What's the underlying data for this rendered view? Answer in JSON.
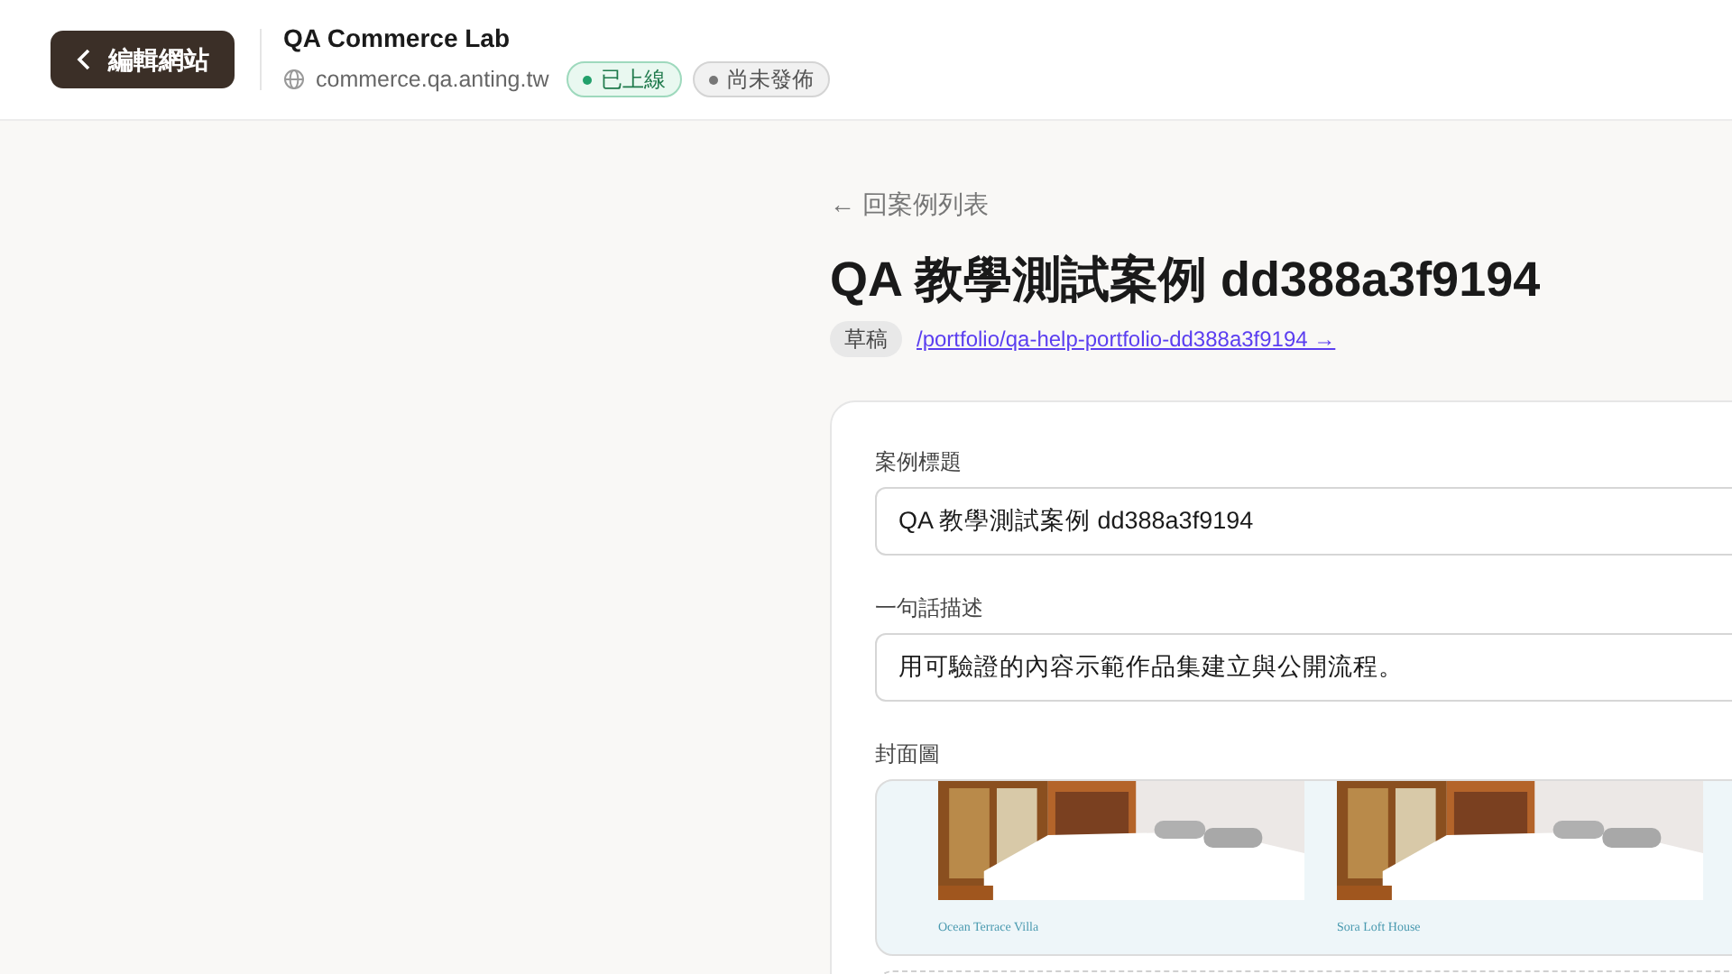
{
  "header": {
    "back_button": "編輯網站",
    "site_name": "QA Commerce Lab",
    "domain": "commerce.qa.anting.tw",
    "badges": [
      {
        "label": "已上線",
        "kind": "live"
      },
      {
        "label": "尚未發佈",
        "kind": "unpublished"
      }
    ]
  },
  "page": {
    "back_link": "← 回案例列表",
    "title": "QA 教學測試案例 dd388a3f9194",
    "status": "草稿",
    "url": "/portfolio/qa-help-portfolio-dd388a3f9194 →"
  },
  "form": {
    "fields": [
      {
        "label": "案例標題",
        "value": "QA 教學測試案例 dd388a3f9194"
      },
      {
        "label": "一句話描述",
        "value": "用可驗證的內容示範作品集建立與公開流程。"
      }
    ],
    "cover": {
      "label": "封面圖",
      "cards": [
        {
          "name": "Ocean Terrace Villa"
        },
        {
          "name": "Sora Loft House"
        }
      ]
    }
  }
}
